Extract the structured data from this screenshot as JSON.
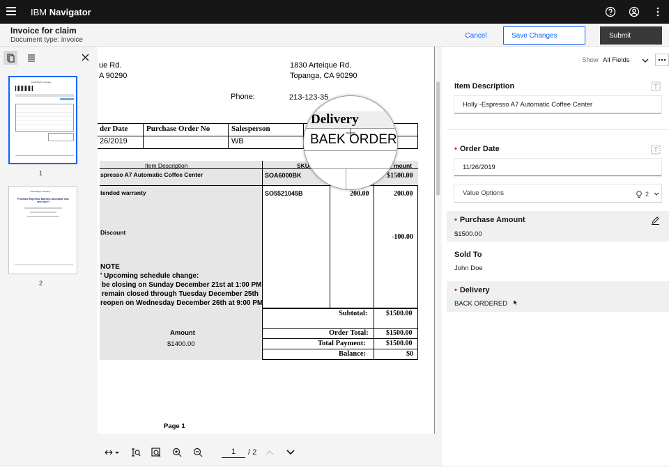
{
  "app": {
    "title_prefix": "IBM",
    "title_bold": "Navigator"
  },
  "header": {
    "doc_title": "Invoice for claim",
    "doc_type": "Document type: invoice",
    "cancel_label": "Cancel",
    "save_label": "Save Changes",
    "submit_label": "Submit"
  },
  "thumbnails": [
    {
      "number": "1"
    },
    {
      "number": "2"
    }
  ],
  "thumb_text": {
    "company": "Ironlet Blyth Company",
    "purchase_title": "Purchase Espresso Machine Automatic now and save!!"
  },
  "document": {
    "addr_left_1": "ue Rd.",
    "addr_left_2": "A 90290",
    "addr_right_1": "1830 Arteique Rd.",
    "addr_right_2": "Topanga, CA 90290",
    "phone_label": "Phone:",
    "phone_value": "213-123-35",
    "hdr_order_date": "der Date",
    "hdr_po": "Purchase Order  No",
    "hdr_salesperson": "Salesperson",
    "val_order_date": "26/2019",
    "val_salesperson": "WB",
    "items_hdr_desc": "Item Description",
    "items_hdr_sku": "SKU#",
    "items_hdr_amount": "mount",
    "item1_desc": "spresso A7 Automatic Coffee Center",
    "item1_sku": "SOA6000BK",
    "item1_amount": "$1500.00",
    "item2_desc": "tended warranty",
    "item2_sku": "SO5521045B",
    "item2_price": "200.00",
    "item2_amount": "200.00",
    "item3_desc": "Discount",
    "item3_amount": "-100.00",
    "note_title": "NOTE",
    "note_1": "' Upcoming schedule change:",
    "note_2": "be closing on Sunday December 21st at 1:00 PM",
    "note_3": "remain closed through Tuesday December 25th",
    "note_4": "reopen on Wednesday December 26th at 9:00 PM",
    "subtotal_label": "Subtotal:",
    "subtotal_value": "$1500.00",
    "amount_label": "Amount",
    "amount_value": "$1400.00",
    "order_total_label": "Order Total:",
    "order_total_value": "$1500.00",
    "total_payment_label": "Total Payment:",
    "total_payment_value": "$1500.00",
    "balance_label": "Balance:",
    "balance_value": "$0",
    "page_footer": "Page 1"
  },
  "magnifier": {
    "heading": "Delivery",
    "value": "BAEK ORDERI"
  },
  "viewer_toolbar": {
    "page_current": "1",
    "page_total": "/ 2"
  },
  "right_panel": {
    "show_label": "Show",
    "show_value": "All Fields",
    "item_description_label": "Item Description",
    "item_description_value": "Holly -Espresso A7 Automatic Coffee Center",
    "order_date_label": "Order Date",
    "order_date_value": "11/26/2019",
    "value_options_label": "Value Options",
    "value_options_count": "2",
    "purchase_amount_label": "Purchase Amount",
    "purchase_amount_value": "$1500.00",
    "sold_to_label": "Sold To",
    "sold_to_value": "John Doe",
    "delivery_label": "Delivery",
    "delivery_value": "BACK ORDERED"
  }
}
